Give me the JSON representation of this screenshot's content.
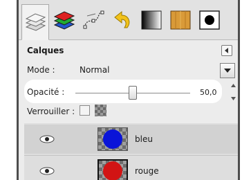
{
  "dialog": {
    "title": "Calques",
    "mode_label": "Mode :",
    "mode_value": "Normal",
    "opacity_label": "Opacité :",
    "opacity_value": "50,0",
    "opacity_fraction": 0.5,
    "lock_label": "Verrouiller :"
  },
  "tabs": [
    {
      "name": "layers-tab-icon",
      "active": true
    },
    {
      "name": "channels-tab-icon",
      "active": false
    },
    {
      "name": "paths-tab-icon",
      "active": false
    },
    {
      "name": "undo-history-tab-icon",
      "active": false
    },
    {
      "name": "gradients-tab-icon",
      "active": false
    },
    {
      "name": "patterns-tab-icon",
      "active": false
    },
    {
      "name": "brushes-tab-icon",
      "active": false
    }
  ],
  "layers": [
    {
      "name": "bleu",
      "color": "#0a14d8",
      "visible": true,
      "selected": true
    },
    {
      "name": "rouge",
      "color": "#d21414",
      "visible": true,
      "selected": false
    }
  ]
}
